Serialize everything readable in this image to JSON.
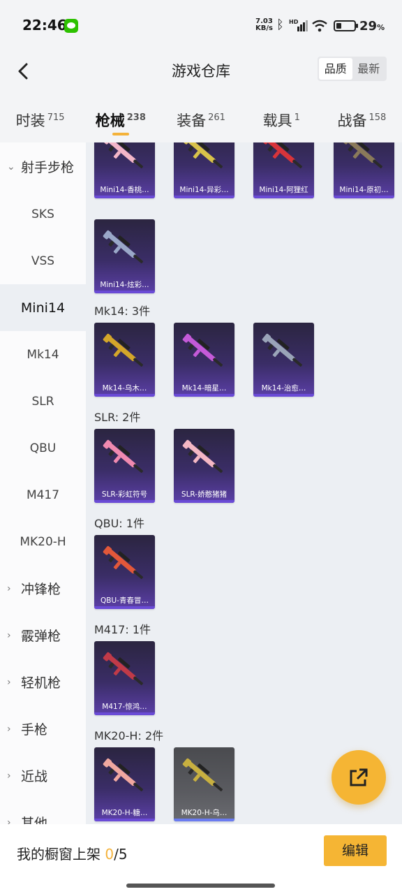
{
  "status_bar": {
    "time": "22:46",
    "net_speed": "7.03",
    "net_unit": "KB/s",
    "hd": "HD",
    "battery_pct": "29",
    "battery_unit": "%",
    "battery_level": 0.29,
    "icons": [
      "wechat-icon",
      "bluetooth-icon",
      "signal-icon",
      "wifi-icon",
      "battery-icon"
    ]
  },
  "header": {
    "title": "游戏仓库",
    "sort_options": [
      "品质",
      "最新"
    ],
    "sort_selected": "品质"
  },
  "tabs": [
    {
      "label": "时装",
      "count": "715"
    },
    {
      "label": "枪械",
      "count": "238",
      "active": true
    },
    {
      "label": "装备",
      "count": "261"
    },
    {
      "label": "载具",
      "count": "1"
    },
    {
      "label": "战备",
      "count": "158"
    }
  ],
  "sidebar": {
    "items": [
      {
        "label": "射手步枪",
        "type": "group",
        "expanded": true
      },
      {
        "label": "SKS"
      },
      {
        "label": "VSS"
      },
      {
        "label": "Mini14",
        "active": true
      },
      {
        "label": "Mk14"
      },
      {
        "label": "SLR"
      },
      {
        "label": "QBU"
      },
      {
        "label": "M417"
      },
      {
        "label": "MK20-H"
      },
      {
        "label": "冲锋枪",
        "type": "group"
      },
      {
        "label": "霰弹枪",
        "type": "group"
      },
      {
        "label": "轻机枪",
        "type": "group"
      },
      {
        "label": "手枪",
        "type": "group"
      },
      {
        "label": "近战",
        "type": "group"
      },
      {
        "label": "其他",
        "type": "group"
      }
    ]
  },
  "sections": [
    {
      "label": "",
      "items": [
        {
          "name": "Mini14-香桃…",
          "color": "#f3b6c8"
        },
        {
          "name": "Mini14-异彩…",
          "color": "#d8c24a"
        },
        {
          "name": "Mini14-阿狸红",
          "color": "#d8343a"
        },
        {
          "name": "Mini14-原初…",
          "color": "#8a7a5a"
        },
        {
          "name": "Mini14-炫彩…",
          "color": "#9aa8c8"
        }
      ]
    },
    {
      "label": "Mk14: 3件",
      "items": [
        {
          "name": "Mk14-乌木…",
          "color": "#d4a62a"
        },
        {
          "name": "Mk14-暗星…",
          "color": "#c45ad8"
        },
        {
          "name": "Mk14-治愈…",
          "color": "#9aa4b8"
        }
      ]
    },
    {
      "label": "SLR: 2件",
      "items": [
        {
          "name": "SLR-彩虹符号",
          "color": "#f08ab0"
        },
        {
          "name": "SLR-娇憨猪猪",
          "color": "#f4b8c4"
        }
      ]
    },
    {
      "label": "QBU: 1件",
      "items": [
        {
          "name": "QBU-青春冒…",
          "color": "#e2583a"
        }
      ]
    },
    {
      "label": "M417: 1件",
      "items": [
        {
          "name": "M417-惊鸿…",
          "color": "#c03a48"
        }
      ]
    },
    {
      "label": "MK20-H: 2件",
      "items": [
        {
          "name": "MK20-H-糖…",
          "color": "#f0a8a0"
        },
        {
          "name": "MK20-H-乌…",
          "color": "#c8b040",
          "gray": true
        }
      ]
    }
  ],
  "bottom": {
    "label_prefix": "我的橱窗上架 ",
    "count": "0",
    "total": "/5",
    "edit_label": "编辑"
  },
  "colors": {
    "accent": "#f5b534",
    "card_bg": "#3a2d66"
  }
}
